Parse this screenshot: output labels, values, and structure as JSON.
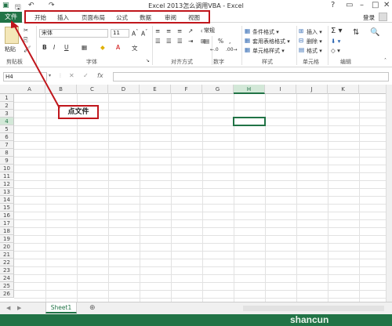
{
  "window": {
    "title": "Excel 2013怎么调用VBA - Excel",
    "help": "?",
    "login": "登录"
  },
  "tabs": {
    "file": "文件",
    "items": [
      "开始",
      "插入",
      "页面布局",
      "公式",
      "数据",
      "审阅",
      "视图"
    ]
  },
  "ribbon": {
    "paste_label": "粘贴",
    "font_name": "宋体",
    "font_size": "11",
    "number_format": "常规",
    "cond_format": "条件格式 ▾",
    "table_format": "套用表格格式 ▾",
    "cell_style": "单元格样式 ▾",
    "insert": "插入 ▾",
    "delete": "删除 ▾",
    "format": "格式 ▾",
    "groups": [
      "剪贴板",
      "字体",
      "对齐方式",
      "数字",
      "样式",
      "单元格",
      "编辑"
    ]
  },
  "formula_bar": {
    "name_box": "H4",
    "fx": "fx"
  },
  "columns": [
    "A",
    "B",
    "C",
    "D",
    "E",
    "F",
    "G",
    "H",
    "I",
    "J",
    "K"
  ],
  "rows": [
    "1",
    "2",
    "3",
    "4",
    "5",
    "6",
    "7",
    "8",
    "9",
    "10",
    "11",
    "12",
    "13",
    "14",
    "15",
    "16",
    "17",
    "18",
    "19",
    "20",
    "21",
    "22",
    "23",
    "24",
    "25",
    "26"
  ],
  "selected_cell": "H4",
  "sheet_tab": "Sheet1",
  "annotation": "点文件",
  "watermark": "shancun"
}
